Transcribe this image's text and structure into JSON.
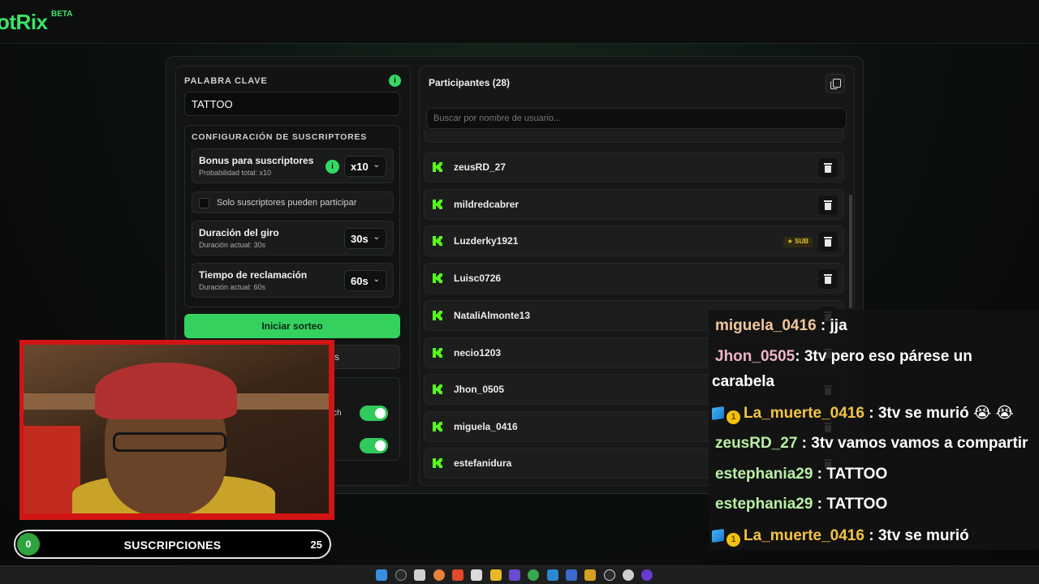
{
  "app": {
    "logo_text": "otRix",
    "logo_badge": "BETA"
  },
  "keyword": {
    "label": "PALABRA CLAVE",
    "value": "TATTOO",
    "info_icon": "i"
  },
  "subscriber_config": {
    "label": "CONFIGURACIÓN DE SUSCRIPTORES",
    "bonus": {
      "title": "Bonus para suscriptores",
      "subtitle": "Probabilidad total: x10",
      "value": "x10"
    },
    "subs_only": {
      "label": "Solo suscriptores pueden participar",
      "checked": false
    },
    "spin_duration": {
      "title": "Duración del giro",
      "subtitle": "Duración actual: 30s",
      "value": "30s"
    },
    "claim_time": {
      "title": "Tiempo de reclamación",
      "subtitle": "Duración actual: 60s",
      "value": "60s"
    }
  },
  "actions": {
    "start_label": "Iniciar sorteo",
    "secondary_label_fragment": "s"
  },
  "toggles": [
    {
      "label_fragment": "ch",
      "on": true
    },
    {
      "label_fragment": "",
      "on": true
    }
  ],
  "participants": {
    "title": "Participantes (28)",
    "search_placeholder": "Buscar por nombre de usuario...",
    "items": [
      {
        "name": "zeusRD_27",
        "sub": false
      },
      {
        "name": "mildredcabrer",
        "sub": false
      },
      {
        "name": "Luzderky1921",
        "sub": true,
        "badge": "SUB"
      },
      {
        "name": "Luisc0726",
        "sub": false
      },
      {
        "name": "NataliAlmonte13",
        "sub": false
      },
      {
        "name": "necio1203",
        "sub": false
      },
      {
        "name": "Jhon_0505",
        "sub": false
      },
      {
        "name": "miguela_0416",
        "sub": false
      },
      {
        "name": "estefanidura",
        "sub": false
      }
    ]
  },
  "chat": [
    {
      "user": "miguela_0416",
      "color": "#f2c79a",
      "text": " : jja",
      "badges": false
    },
    {
      "user": "Jhon_0505",
      "color": "#f0b4c8",
      "text": ": 3tv pero eso párese un",
      "badges": false
    },
    {
      "user": "",
      "color": "#ffffff",
      "text": "carabela",
      "badges": false
    },
    {
      "user": "La_muerte_0416",
      "color": "#f5c341",
      "text": " : 3tv se murió 😭 😭",
      "badges": true
    },
    {
      "user": "zeusRD_27",
      "color": "#b8f0a4",
      "text": " : 3tv vamos vamos a compartir",
      "badges": false
    },
    {
      "user": "estephania29",
      "color": "#b8f0a4",
      "text": " : TATTOO",
      "badges": false
    },
    {
      "user": "estephania29",
      "color": "#b8f0a4",
      "text": " : TATTOO",
      "badges": false
    },
    {
      "user": "La_muerte_0416",
      "color": "#f5c341",
      "text": " : 3tv se murió",
      "badges": true
    }
  ],
  "sub_goal": {
    "current": "0",
    "label": "SUSCRIPCIONES",
    "goal": "25"
  },
  "colors": {
    "accent": "#34d15f",
    "sub_badge": "#e2c23a",
    "webcam_border": "#d11414"
  }
}
